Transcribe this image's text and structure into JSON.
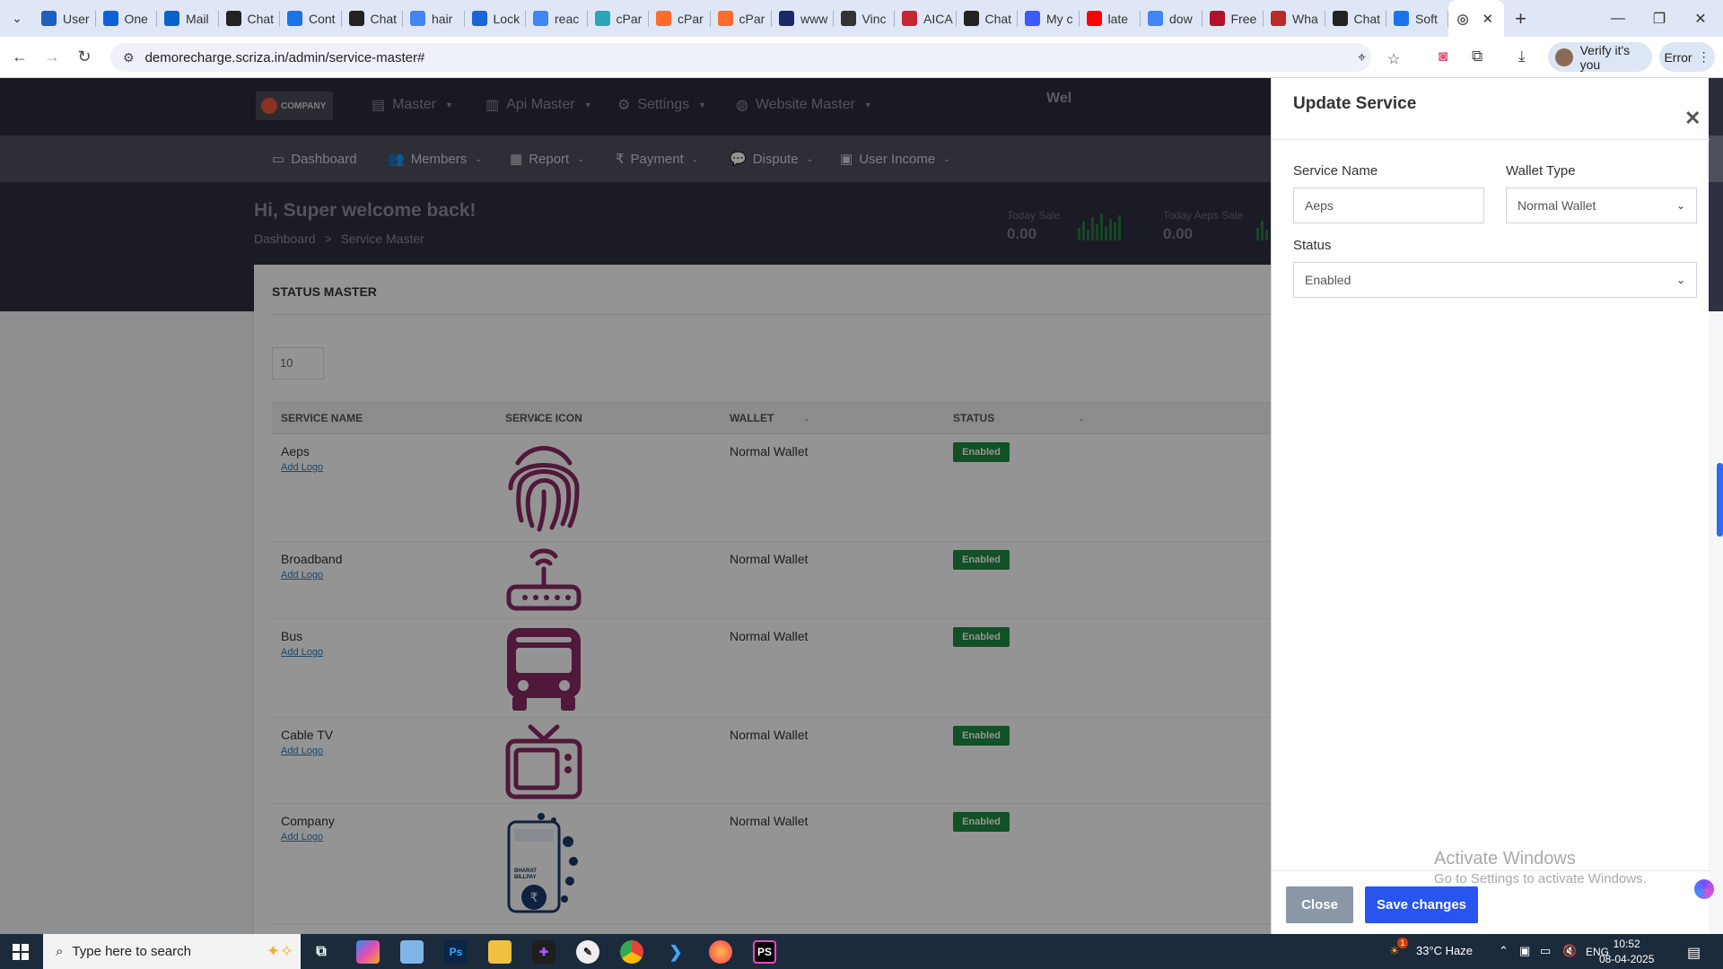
{
  "browser": {
    "tabs": [
      {
        "label": "User",
        "icon": "word-icon",
        "color": "#1e5fbf"
      },
      {
        "label": "One",
        "icon": "onedrive-icon",
        "color": "#0b62d6"
      },
      {
        "label": "Mail",
        "icon": "outlook-icon",
        "color": "#0a64c8"
      },
      {
        "label": "Chat",
        "icon": "chatgpt-icon",
        "color": "#222222"
      },
      {
        "label": "Cont",
        "icon": "info-icon",
        "color": "#1a73e8"
      },
      {
        "label": "Chat",
        "icon": "chatgpt-icon",
        "color": "#222222"
      },
      {
        "label": "hair",
        "icon": "google-icon",
        "color": "#4285f4"
      },
      {
        "label": "Lock",
        "icon": "jira-icon",
        "color": "#1d64d8"
      },
      {
        "label": "reac",
        "icon": "google-icon",
        "color": "#4285f4"
      },
      {
        "label": "cPar",
        "icon": "cpanel-icon",
        "color": "#2aa6b8"
      },
      {
        "label": "cPar",
        "icon": "cpanel-icon",
        "color": "#ff6c2c"
      },
      {
        "label": "cPar",
        "icon": "cpanel-icon",
        "color": "#ff6c2c"
      },
      {
        "label": "www",
        "icon": "bs-icon",
        "color": "#1b2a66"
      },
      {
        "label": "Vinc",
        "icon": "vinci-icon",
        "color": "#333333"
      },
      {
        "label": "AICA",
        "icon": "aica-icon",
        "color": "#c4272f"
      },
      {
        "label": "Chat",
        "icon": "chatgpt-icon",
        "color": "#222222"
      },
      {
        "label": "My c",
        "icon": "people-icon",
        "color": "#3d5afe"
      },
      {
        "label": "late",
        "icon": "youtube-icon",
        "color": "#ff0000"
      },
      {
        "label": "dow",
        "icon": "google-icon",
        "color": "#4285f4"
      },
      {
        "label": "Free",
        "icon": "fsf-icon",
        "color": "#b0122b"
      },
      {
        "label": "Wha",
        "icon": "quora-icon",
        "color": "#b92b27"
      },
      {
        "label": "Chat",
        "icon": "chatgpt-icon",
        "color": "#222222"
      },
      {
        "label": "Soft",
        "icon": "chart-icon",
        "color": "#1a73e8"
      }
    ],
    "url": "demorecharge.scriza.in/admin/service-master#",
    "verify_label": "Verify it's you",
    "error_label": "Error"
  },
  "nav": {
    "logo_text": "COMPANY",
    "top_items": [
      "Master",
      "Api Master",
      "Settings",
      "Website Master"
    ],
    "welcome_truncated": "Wel",
    "sub_items": [
      "Dashboard",
      "Members",
      "Report",
      "Payment",
      "Dispute",
      "User Income"
    ]
  },
  "hero": {
    "welcome": "Hi, Super welcome back!",
    "crumb_home": "Dashboard",
    "crumb_sep": ">",
    "crumb_current": "Service Master",
    "stats": [
      {
        "label": "Today Sale",
        "value": "0.00"
      },
      {
        "label": "Today Aeps Sale",
        "value": "0.00"
      }
    ]
  },
  "table": {
    "title": "STATUS MASTER",
    "page_size": "10",
    "headers": [
      "SERVICE NAME",
      "SERVICE ICON",
      "WALLET",
      "STATUS"
    ],
    "rows": [
      {
        "name": "Aeps",
        "add_logo": "Add Logo",
        "wallet": "Normal Wallet",
        "status": "Enabled",
        "icon": "fingerprint-icon"
      },
      {
        "name": "Broadband",
        "add_logo": "Add Logo",
        "wallet": "Normal Wallet",
        "status": "Enabled",
        "icon": "router-icon"
      },
      {
        "name": "Bus",
        "add_logo": "Add Logo",
        "wallet": "Normal Wallet",
        "status": "Enabled",
        "icon": "bus-icon"
      },
      {
        "name": "Cable TV",
        "add_logo": "Add Logo",
        "wallet": "Normal Wallet",
        "status": "Enabled",
        "icon": "tv-icon"
      },
      {
        "name": "Company",
        "add_logo": "Add Logo",
        "wallet": "Normal Wallet",
        "status": "Enabled",
        "icon": "bharat-billpay-icon"
      }
    ],
    "bbps_text": "BHARAT BILLPAY"
  },
  "modal": {
    "title": "Update Service",
    "service_name_label": "Service Name",
    "service_name_value": "Aeps",
    "wallet_type_label": "Wallet Type",
    "wallet_type_value": "Normal Wallet",
    "status_label": "Status",
    "status_value": "Enabled",
    "close_label": "Close",
    "save_label": "Save changes"
  },
  "watermark": {
    "line1": "Activate Windows",
    "line2": "Go to Settings to activate Windows."
  },
  "taskbar": {
    "search_placeholder": "Type here to search",
    "weather": "33°C  Haze",
    "lang": "ENG",
    "time": "10:52",
    "date": "08-04-2025",
    "weather_badge": "1"
  },
  "colors": {
    "accent": "#2854f0",
    "badge_green": "#1f8a43",
    "icon_purple": "#8a2a64"
  }
}
